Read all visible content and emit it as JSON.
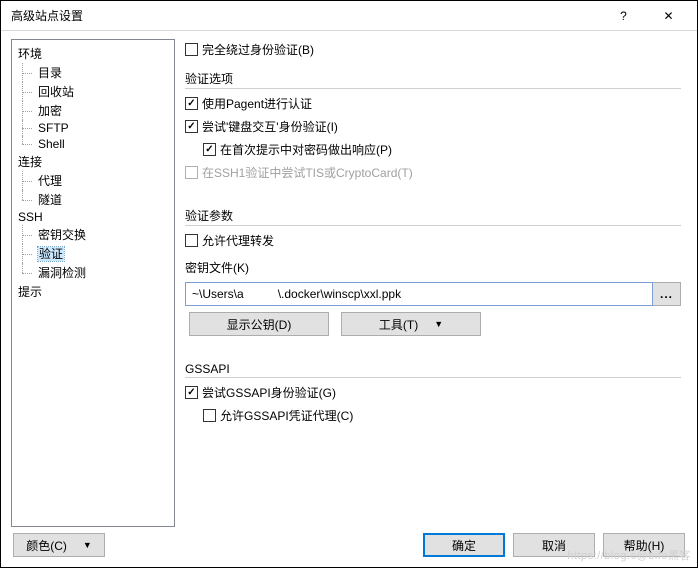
{
  "title": "高级站点设置",
  "titlebar": {
    "help": "?",
    "close": "✕"
  },
  "tree": {
    "env": {
      "label": "环境",
      "children": [
        "目录",
        "回收站",
        "加密",
        "SFTP",
        "Shell"
      ]
    },
    "conn": {
      "label": "连接",
      "children": [
        "代理",
        "隧道"
      ]
    },
    "ssh": {
      "label": "SSH",
      "children": [
        "密钥交换",
        "验证",
        "漏洞检测"
      ],
      "selected": "验证"
    },
    "hint": {
      "label": "提示"
    }
  },
  "panel": {
    "bypass": "完全绕过身份验证(B)",
    "auth_options_caption": "验证选项",
    "use_pagent": "使用Pagent进行认证",
    "kbd_interactive": "尝试'键盘交互'身份验证(I)",
    "respond_pw": "在首次提示中对密码做出响应(P)",
    "tis": "在SSH1验证中尝试TIS或CryptoCard(T)",
    "auth_params_caption": "验证参数",
    "agent_fwd": "允许代理转发",
    "key_file_label": "密钥文件(K)",
    "key_file_value_prefix": "~\\Users\\a",
    "key_file_value_mask": "████",
    "key_file_value_suffix": "\\.docker\\winscp\\xxl.ppk",
    "browse": "...",
    "show_pubkey": "显示公钥(D)",
    "tools": "工具(T)",
    "gssapi_caption": "GSSAPI",
    "gssapi_auth": "尝试GSSAPI身份验证(G)",
    "gssapi_proxy": "允许GSSAPI凭证代理(C)"
  },
  "footer": {
    "color": "颜色(C)",
    "ok": "确定",
    "cancel": "取消",
    "help": "帮助(H)"
  },
  "watermark": "https://blog.c@bifo黑客"
}
